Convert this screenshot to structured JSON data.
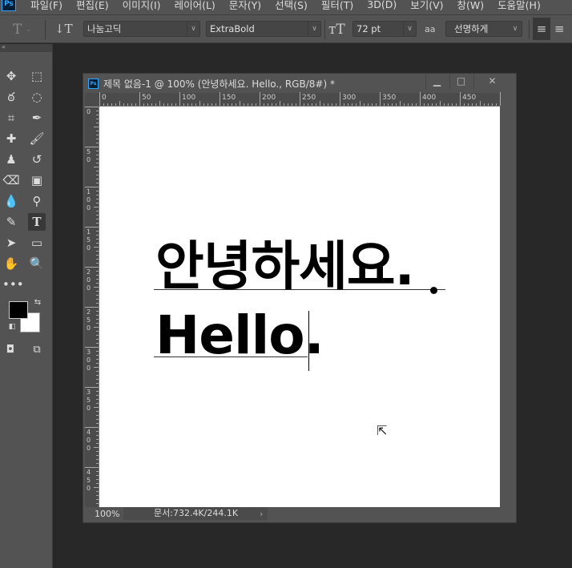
{
  "menubar": {
    "items": [
      "파일(F)",
      "편집(E)",
      "이미지(I)",
      "레이어(L)",
      "문자(Y)",
      "선택(S)",
      "필터(T)",
      "3D(D)",
      "보기(V)",
      "창(W)",
      "도움말(H)"
    ],
    "logo": "Ps"
  },
  "options": {
    "font_family": "나눔고딕",
    "font_style": "ExtraBold",
    "font_size": "72 pt",
    "antialias": "선명하게",
    "antialias_icon": "aa"
  },
  "document": {
    "title": "제목 없음-1 @ 100% (안녕하세요. Hello., RGB/8#) *",
    "ruler_top": [
      "0",
      "50",
      "100",
      "150",
      "200",
      "250",
      "300",
      "350",
      "400",
      "450"
    ],
    "ruler_left": [
      "0",
      "50",
      "100",
      "150",
      "200",
      "250",
      "300",
      "350",
      "400",
      "450"
    ],
    "text_lines": [
      "안녕하세요.",
      "Hello."
    ],
    "zoom": "100%",
    "doc_info": "문서:732.4K/244.1K"
  },
  "tools": [
    "move",
    "marquee",
    "lasso",
    "quick-select",
    "crop",
    "eyedropper",
    "healing",
    "brush",
    "stamp",
    "history-brush",
    "eraser",
    "gradient",
    "blur",
    "dodge",
    "pen",
    "type",
    "path-select",
    "rectangle",
    "hand",
    "zoom"
  ]
}
